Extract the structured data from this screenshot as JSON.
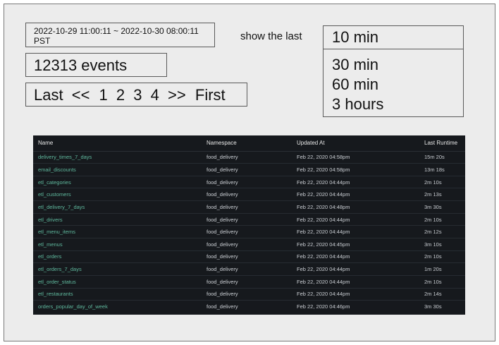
{
  "filters": {
    "date_range_line1": "2022-10-29 11:00:11 ~ 2022-10-30 08:00:11",
    "date_range_line2": "PST",
    "events_count": "12313 events",
    "show_last_label": "show the last"
  },
  "pager": {
    "last": "Last",
    "prev": "<<",
    "pages": [
      "1",
      "2",
      "3",
      "4"
    ],
    "next": ">>",
    "first": "First"
  },
  "time_select": {
    "selected": "10 min",
    "options": [
      "30 min",
      "60 min",
      "3 hours"
    ]
  },
  "table": {
    "headers": [
      "Name",
      "Namespace",
      "Updated At",
      "Last Runtime"
    ],
    "rows": [
      [
        "delivery_times_7_days",
        "food_delivery",
        "Feb 22, 2020 04:58pm",
        "15m 20s"
      ],
      [
        "email_discounts",
        "food_delivery",
        "Feb 22, 2020 04:58pm",
        "13m 18s"
      ],
      [
        "etl_categories",
        "food_delivery",
        "Feb 22, 2020 04:44pm",
        "2m 10s"
      ],
      [
        "etl_customers",
        "food_delivery",
        "Feb 22, 2020 04:44pm",
        "2m 13s"
      ],
      [
        "etl_delivery_7_days",
        "food_delivery",
        "Feb 22, 2020 04:48pm",
        "3m 30s"
      ],
      [
        "etl_drivers",
        "food_delivery",
        "Feb 22, 2020 04:44pm",
        "2m 10s"
      ],
      [
        "etl_menu_items",
        "food_delivery",
        "Feb 22, 2020 04:44pm",
        "2m 12s"
      ],
      [
        "etl_menus",
        "food_delivery",
        "Feb 22, 2020 04:45pm",
        "3m 10s"
      ],
      [
        "etl_orders",
        "food_delivery",
        "Feb 22, 2020 04:44pm",
        "2m 10s"
      ],
      [
        "etl_orders_7_days",
        "food_delivery",
        "Feb 22, 2020 04:44pm",
        "1m 20s"
      ],
      [
        "etl_order_status",
        "food_delivery",
        "Feb 22, 2020 04:44pm",
        "2m 10s"
      ],
      [
        "etl_restaurants",
        "food_delivery",
        "Feb 22, 2020 04:44pm",
        "2m 14s"
      ],
      [
        "orders_popular_day_of_week",
        "food_delivery",
        "Feb 22, 2020 04:46pm",
        "3m 30s"
      ]
    ]
  },
  "colors": {
    "background": "#ececec",
    "table_background": "#16191d",
    "job_name": "#5fb89d"
  }
}
